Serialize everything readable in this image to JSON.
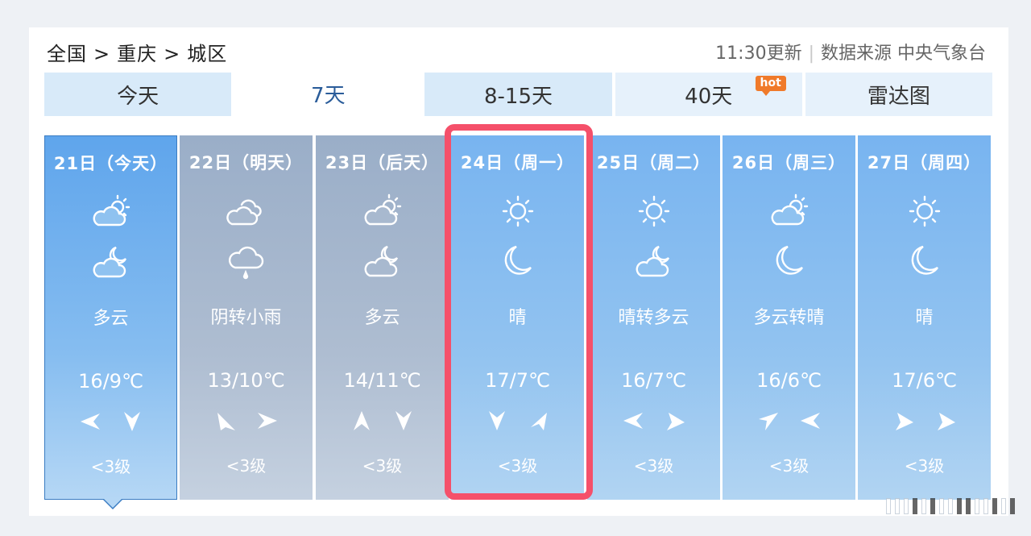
{
  "breadcrumb": {
    "items": [
      "全国",
      "重庆",
      "城区"
    ],
    "separator": ">"
  },
  "meta": {
    "update_time": "11:30更新",
    "source": "数据来源 中央气象台"
  },
  "tabs": [
    {
      "label": "今天"
    },
    {
      "label": "7天",
      "active": true
    },
    {
      "label": "8-15天"
    },
    {
      "label": "40天",
      "badge": "hot"
    },
    {
      "label": "雷达图"
    }
  ],
  "days": [
    {
      "date": "21日（今天）",
      "day_icon": "partly-cloudy-icon",
      "night_icon": "partly-cloudy-night-icon",
      "desc": "多云",
      "temp": "16/9℃",
      "wind1": "wind-west-icon",
      "wind2": "wind-south-icon",
      "wind_level": "<3级"
    },
    {
      "date": "22日（明天）",
      "day_icon": "cloudy-icon",
      "night_icon": "light-rain-icon",
      "desc": "阴转小雨",
      "temp": "13/10℃",
      "wind1": "wind-northeast-icon",
      "wind2": "wind-east-icon",
      "wind_level": "<3级"
    },
    {
      "date": "23日（后天）",
      "day_icon": "partly-cloudy-icon",
      "night_icon": "partly-cloudy-night-icon",
      "desc": "多云",
      "temp": "14/11℃",
      "wind1": "wind-north-icon",
      "wind2": "wind-south-icon",
      "wind_level": "<3级"
    },
    {
      "date": "24日（周一）",
      "day_icon": "sunny-icon",
      "night_icon": "moon-icon",
      "desc": "晴",
      "temp": "17/7℃",
      "wind1": "wind-south-icon",
      "wind2": "wind-northeast-icon",
      "wind_level": "<3级"
    },
    {
      "date": "25日（周二）",
      "day_icon": "sunny-icon",
      "night_icon": "partly-cloudy-night-icon",
      "desc": "晴转多云",
      "temp": "16/7℃",
      "wind1": "wind-west-icon",
      "wind2": "wind-southeast-icon",
      "wind_level": "<3级"
    },
    {
      "date": "26日（周三）",
      "day_icon": "partly-cloudy-icon",
      "night_icon": "moon-icon",
      "desc": "多云转晴",
      "temp": "16/6℃",
      "wind1": "wind-northwest-icon",
      "wind2": "wind-west-icon",
      "wind_level": "<3级"
    },
    {
      "date": "27日（周四）",
      "day_icon": "sunny-icon",
      "night_icon": "moon-icon",
      "desc": "晴",
      "temp": "17/6℃",
      "wind1": "wind-southeast-icon",
      "wind2": "wind-southeast-icon",
      "wind_level": "<3级"
    }
  ],
  "colors": {
    "highlight": "#f5506a",
    "tab_active_text": "#2b5d9a",
    "hot_badge": "#f07a2a"
  }
}
